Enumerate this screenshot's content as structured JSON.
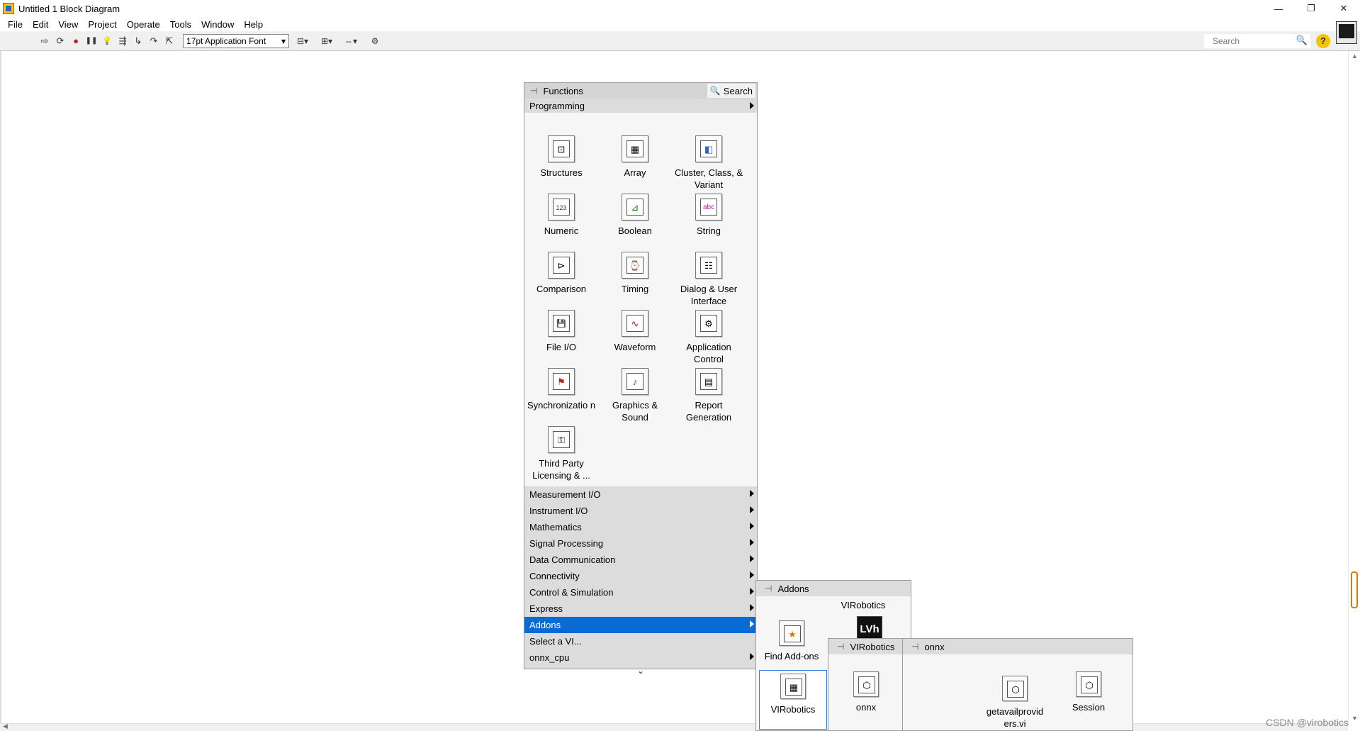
{
  "window": {
    "title": "Untitled 1 Block Diagram",
    "minimize": "—",
    "restore": "❐",
    "close": "✕"
  },
  "menu": [
    "File",
    "Edit",
    "View",
    "Project",
    "Operate",
    "Tools",
    "Window",
    "Help"
  ],
  "toolbar": {
    "run": "⇨",
    "run_continuous": "⟳",
    "abort": "●",
    "pause": "❚❚",
    "highlight": "💡",
    "retain": "⇶",
    "step_into": "↳",
    "step_over": "↷",
    "step_out": "⇱",
    "font_label": "17pt Application Font",
    "font_dropdown": "▾",
    "align_label": "⊟▾",
    "distribute_label": "⊞▾",
    "resize_label": "⇔▾",
    "reorder_label": "⚙",
    "search_placeholder": "Search",
    "search_icon": "🔍",
    "help_label": "?"
  },
  "functions_palette": {
    "title": "Functions",
    "search_label": "Search",
    "pin_icon": "⊣",
    "top_category": "Programming",
    "items": [
      {
        "label": "Structures",
        "glyph": "⊡"
      },
      {
        "label": "Array",
        "glyph": "▦"
      },
      {
        "label": "Cluster, Class, & Variant",
        "glyph": "◧"
      },
      {
        "label": "Numeric",
        "glyph": "123"
      },
      {
        "label": "Boolean",
        "glyph": "⊿"
      },
      {
        "label": "String",
        "glyph": "abc"
      },
      {
        "label": "Comparison",
        "glyph": "⊳"
      },
      {
        "label": "Timing",
        "glyph": "⌚"
      },
      {
        "label": "Dialog & User Interface",
        "glyph": "☷"
      },
      {
        "label": "File I/O",
        "glyph": "💾"
      },
      {
        "label": "Waveform",
        "glyph": "∿"
      },
      {
        "label": "Application Control",
        "glyph": "⚙"
      },
      {
        "label": "Synchronizatio n",
        "glyph": "⚑"
      },
      {
        "label": "Graphics & Sound",
        "glyph": "♪"
      },
      {
        "label": "Report Generation",
        "glyph": "▤"
      },
      {
        "label": "Third Party Licensing & ...",
        "glyph": "⚿"
      }
    ],
    "categories": [
      "Measurement I/O",
      "Instrument I/O",
      "Mathematics",
      "Signal Processing",
      "Data Communication",
      "Connectivity",
      "Control & Simulation",
      "Express",
      "Addons",
      "Select a VI...",
      "onnx_cpu"
    ],
    "selected_category": "Addons",
    "more_label": "⌄"
  },
  "addons_palette": {
    "title": "Addons",
    "section": "VIRobotics",
    "find_addons_label": "Find Add-ons",
    "find_addons_glyph": "★",
    "lvh_glyph": "LVh",
    "virobotics_label": "VIRobotics",
    "virobotics_glyph": "▦"
  },
  "virobotics_palette": {
    "title": "VIRobotics",
    "onnx_label": "onnx",
    "onnx_glyph": "⬡"
  },
  "onnx_palette": {
    "title": "onnx",
    "items": [
      {
        "label": "getavailprovid ers.vi",
        "glyph": "⬡"
      },
      {
        "label": "Session",
        "glyph": "⬡"
      }
    ]
  },
  "watermark": "CSDN @virobotics"
}
